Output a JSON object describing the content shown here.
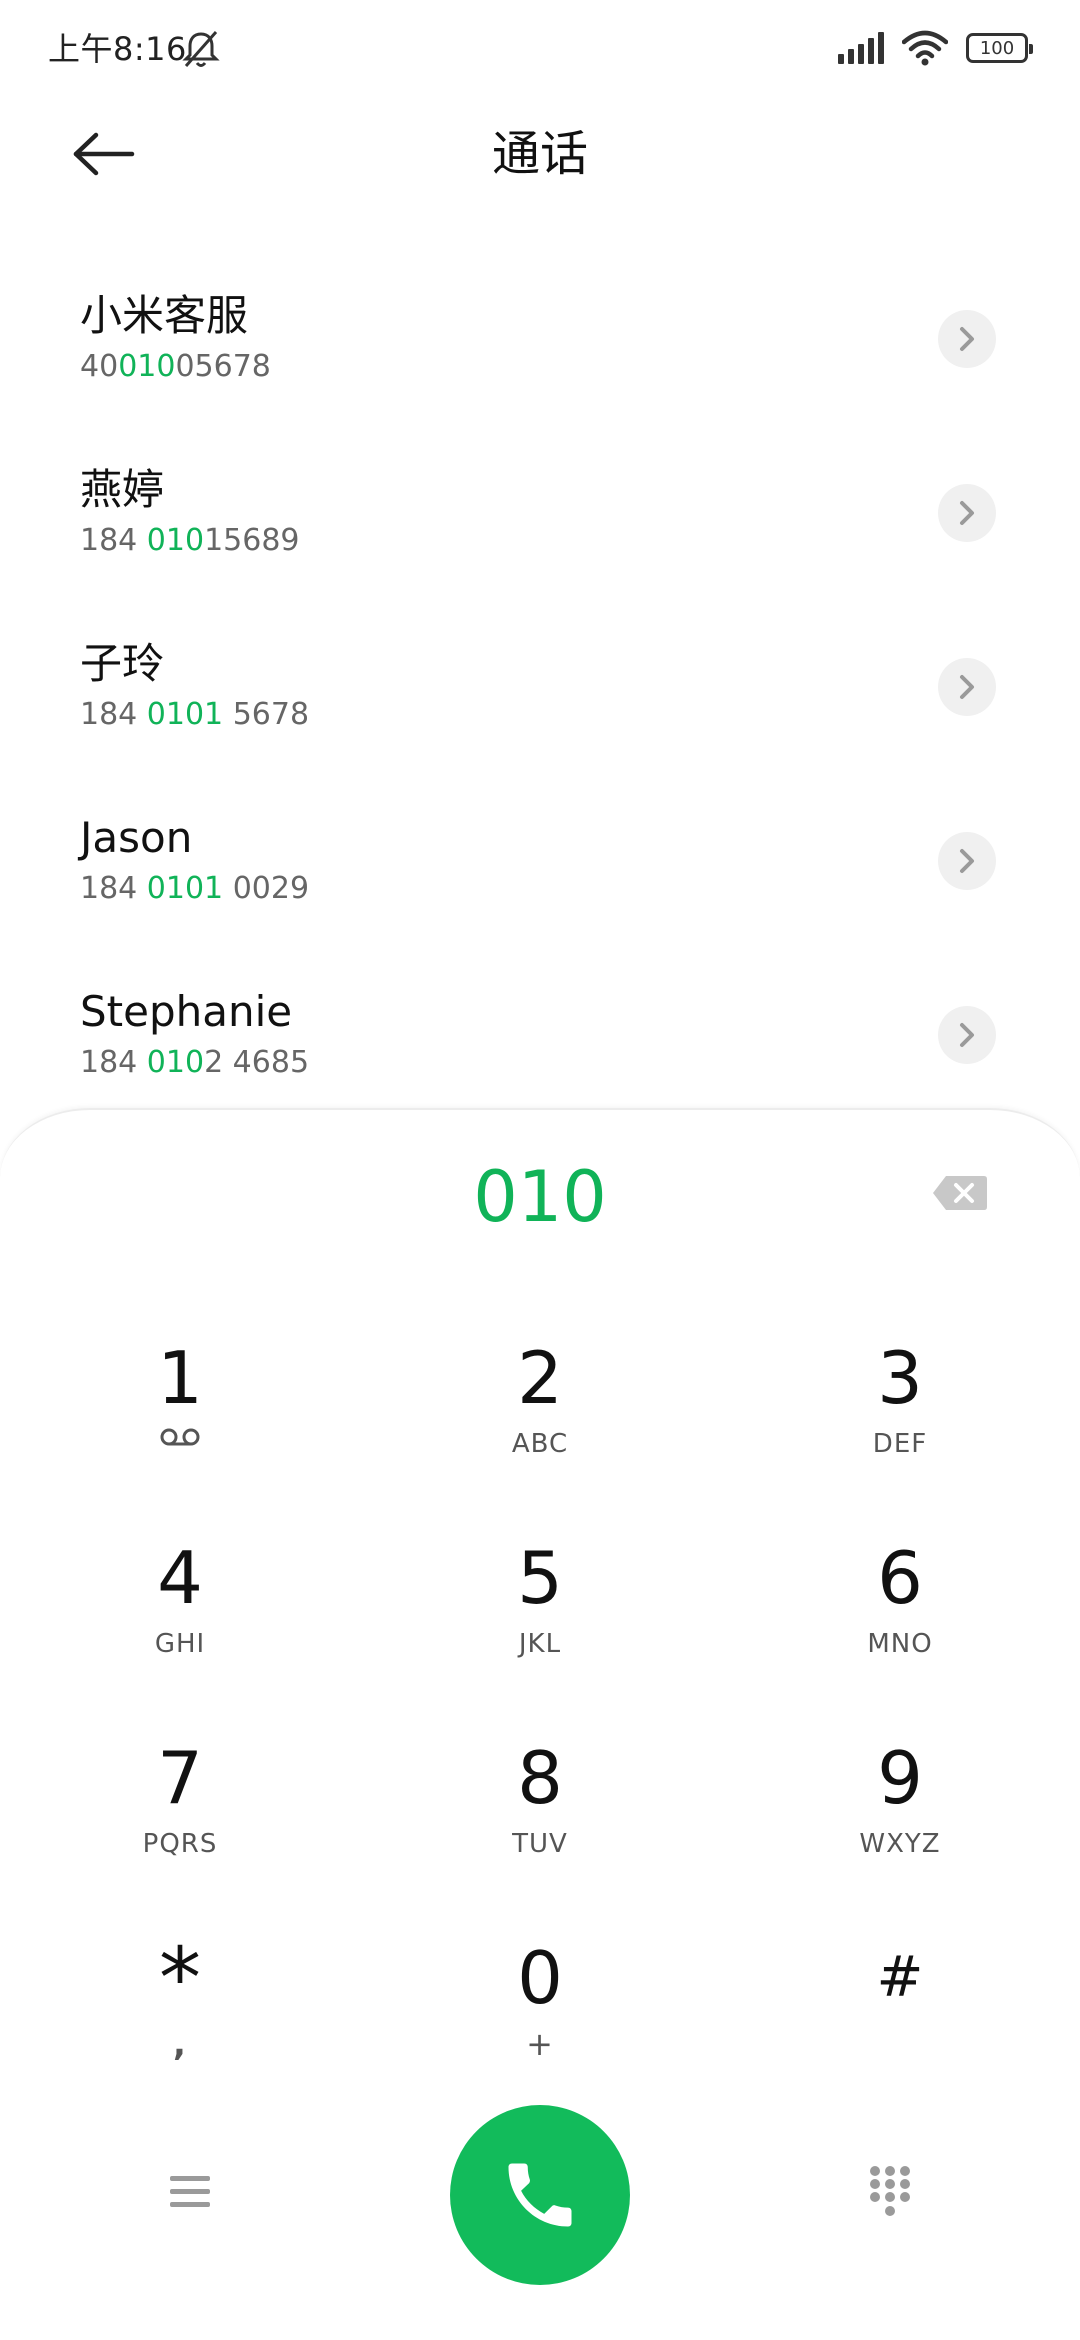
{
  "status_bar": {
    "time": "上午8:16",
    "battery": "100"
  },
  "header": {
    "title": "通话"
  },
  "contacts": [
    {
      "name": "小米客服",
      "number_parts": [
        "40",
        "010",
        "05678"
      ]
    },
    {
      "name": "燕婷",
      "number_parts": [
        "184 ",
        "010",
        "15689"
      ]
    },
    {
      "name": "子玲",
      "number_parts": [
        "184 ",
        "0101",
        " 5678"
      ]
    },
    {
      "name": "Jason",
      "number_parts": [
        "184 ",
        "0101",
        " 0029"
      ]
    },
    {
      "name": "Stephanie",
      "number_parts": [
        "184 ",
        "010",
        "2 4685"
      ]
    }
  ],
  "dialpad": {
    "input": "010",
    "keys": [
      {
        "digit": "1",
        "letters": ""
      },
      {
        "digit": "2",
        "letters": "ABC"
      },
      {
        "digit": "3",
        "letters": "DEF"
      },
      {
        "digit": "4",
        "letters": "GHI"
      },
      {
        "digit": "5",
        "letters": "JKL"
      },
      {
        "digit": "6",
        "letters": "MNO"
      },
      {
        "digit": "7",
        "letters": "PQRS"
      },
      {
        "digit": "8",
        "letters": "TUV"
      },
      {
        "digit": "9",
        "letters": "WXYZ"
      },
      {
        "digit": "*",
        "letters": ","
      },
      {
        "digit": "0",
        "letters": "+"
      },
      {
        "digit": "#",
        "letters": ""
      }
    ]
  },
  "icons": {
    "back": "arrow-left-icon",
    "mute": "bell-off-icon",
    "signal": "signal-icon",
    "wifi": "wifi-icon",
    "battery": "battery-icon",
    "chevron": "chevron-right-icon",
    "delete": "backspace-icon",
    "voicemail": "voicemail-icon",
    "menu": "menu-icon",
    "call": "phone-icon",
    "keypad": "dialpad-icon"
  },
  "colors": {
    "accent": "#10b358",
    "call_button": "#12bb5b",
    "secondary_text": "#666666"
  }
}
